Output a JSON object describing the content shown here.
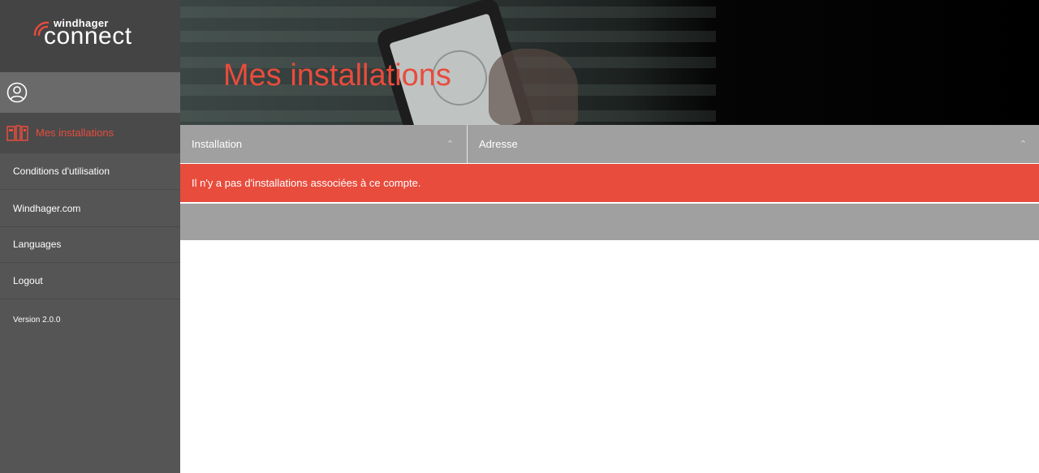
{
  "brand": {
    "top": "windhager",
    "main": "connect",
    "accent_color": "#e84c3d"
  },
  "sidebar": {
    "user_icon": "user-circle-icon",
    "active_item": {
      "label": "Mes installations",
      "icon": "installations-icon"
    },
    "items": [
      {
        "label": "Conditions d'utilisation"
      },
      {
        "label": "Windhager.com"
      },
      {
        "label": "Languages"
      },
      {
        "label": "Logout"
      }
    ],
    "version": "Version 2.0.0"
  },
  "hero": {
    "title": "Mes installations"
  },
  "table": {
    "columns": [
      {
        "label": "Installation",
        "sort_icon": "chevron-up-icon"
      },
      {
        "label": "Adresse",
        "sort_icon": "chevron-up-icon"
      }
    ],
    "empty_message": "Il n'y a pas d'installations associées à ce compte."
  }
}
